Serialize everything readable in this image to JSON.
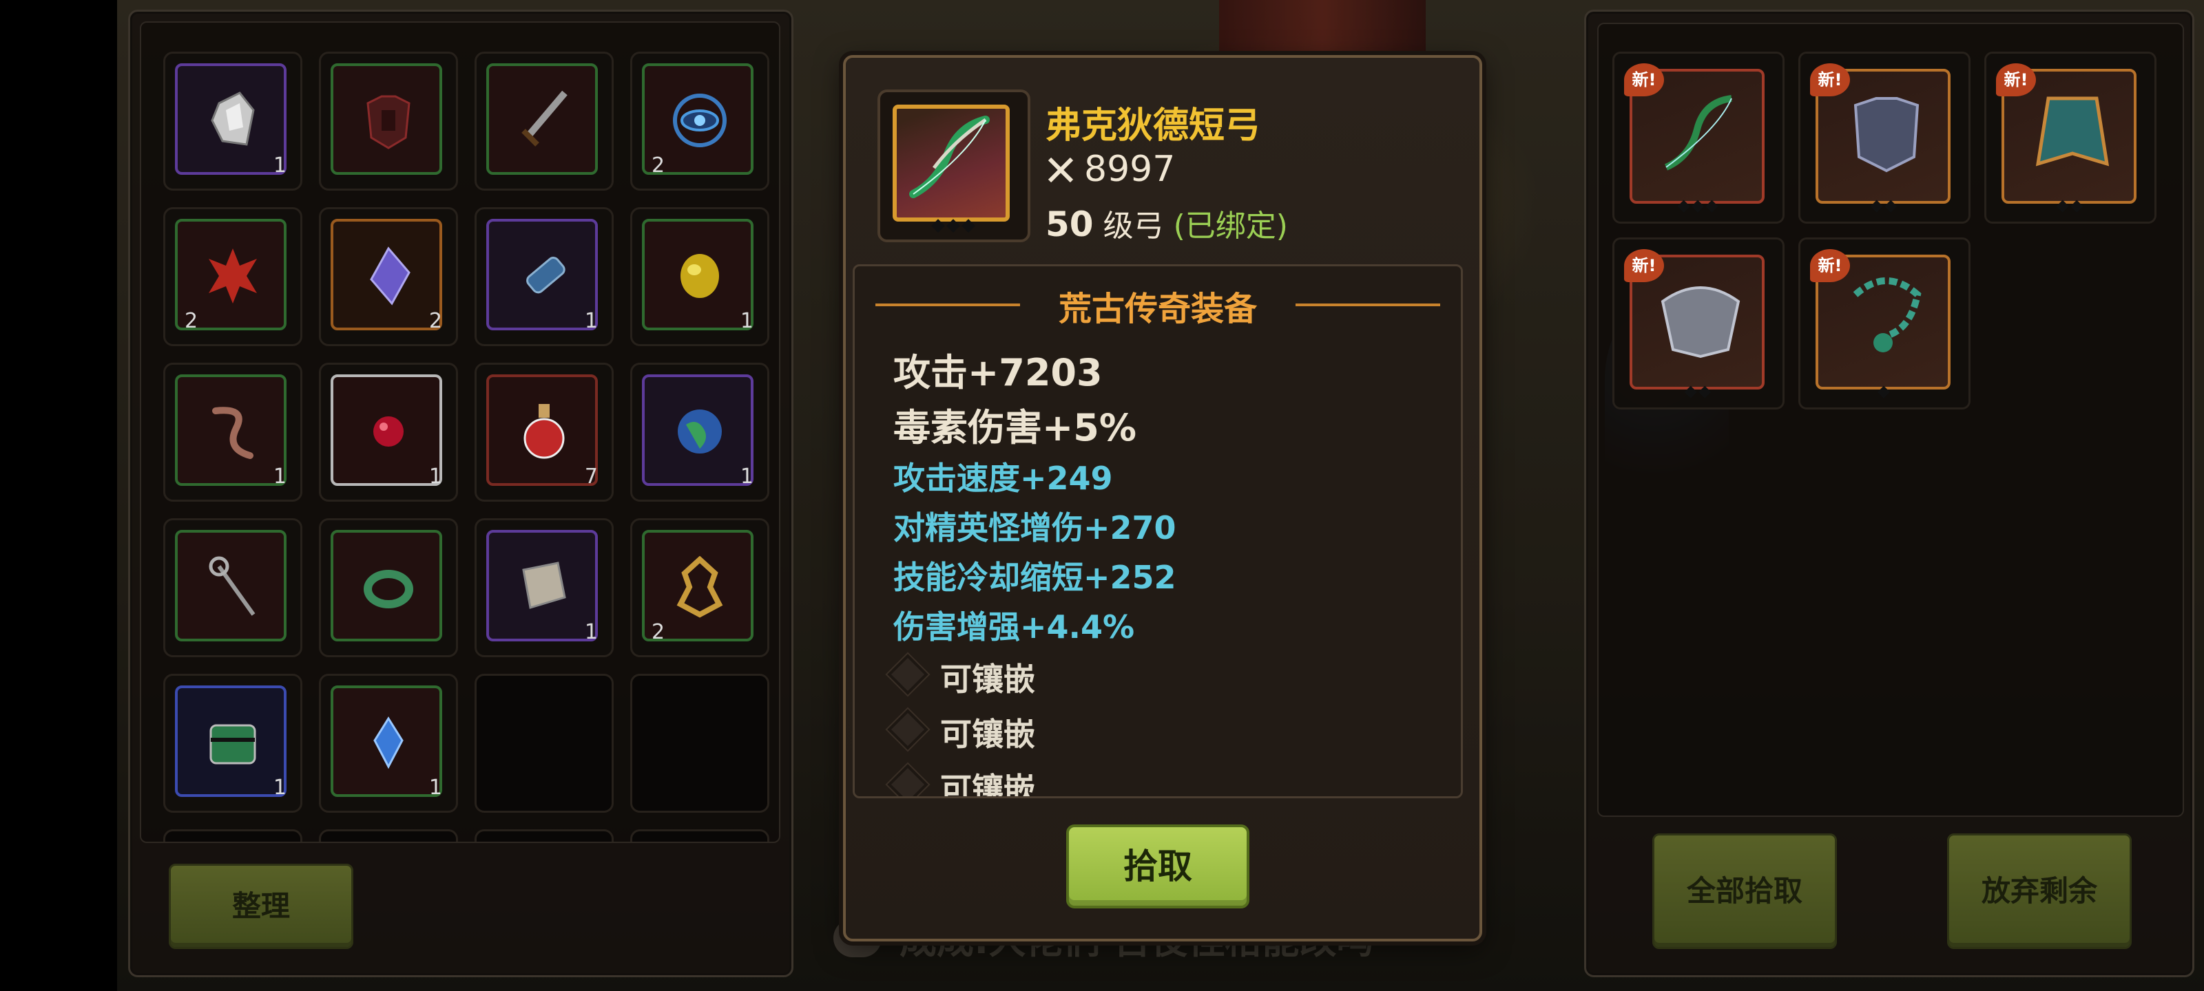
{
  "inventory": {
    "sort_button": "整理",
    "slots": [
      {
        "icon": "crystal-shard-icon",
        "count": "1"
      },
      {
        "icon": "dark-armor-icon",
        "count": ""
      },
      {
        "icon": "sword-icon",
        "count": ""
      },
      {
        "icon": "eye-emblem-icon",
        "count": "2"
      },
      {
        "icon": "red-emblem-icon",
        "count": "2"
      },
      {
        "icon": "purple-gem-icon",
        "count": "2"
      },
      {
        "icon": "blue-scroll-icon",
        "count": "1"
      },
      {
        "icon": "gold-orb-icon",
        "count": "1"
      },
      {
        "icon": "rope-icon",
        "count": "1"
      },
      {
        "icon": "red-orb-icon",
        "count": "1"
      },
      {
        "icon": "potion-icon",
        "count": "7"
      },
      {
        "icon": "globe-icon",
        "count": "1"
      },
      {
        "icon": "staff-icon",
        "count": ""
      },
      {
        "icon": "ring-icon",
        "count": ""
      },
      {
        "icon": "parchment-icon",
        "count": "1"
      },
      {
        "icon": "gold-emblem-icon",
        "count": "2"
      },
      {
        "icon": "chest-icon",
        "count": "1"
      },
      {
        "icon": "blue-crystal-icon",
        "count": "1"
      }
    ]
  },
  "item": {
    "name": "弗克狄德短弓",
    "power": "8997",
    "level": "50",
    "level_type": "级弓",
    "bound": "(已绑定)",
    "quality": "荒古传奇装备",
    "main_stats": [
      "攻击+7203"
    ],
    "special_stat_label": "毒素伤害",
    "special_stat_value": "+5%",
    "sub_stats": [
      "攻击速度+249",
      "对精英怪增伤+270",
      "技能冷却缩短+252",
      "伤害增强+4.4%"
    ],
    "sockets": [
      "可镶嵌",
      "可镶嵌",
      "可镶嵌"
    ],
    "pickup_button": "拾取"
  },
  "loot": {
    "new_tag": "新!",
    "items": [
      {
        "icon": "bow-icon",
        "diamonds": "◆◆◆"
      },
      {
        "icon": "chest-armor-icon",
        "diamonds": "◆◆"
      },
      {
        "icon": "cloak-icon",
        "diamonds": "◆◆"
      },
      {
        "icon": "shoulder-armor-icon",
        "diamonds": "◆◆"
      },
      {
        "icon": "necklace-icon",
        "diamonds": "◆"
      }
    ],
    "pickup_all_button": "全部拾取",
    "discard_button": "放弃剩余"
  },
  "chat": {
    "message": "成成:大佬们 召役怪格能改吗"
  }
}
